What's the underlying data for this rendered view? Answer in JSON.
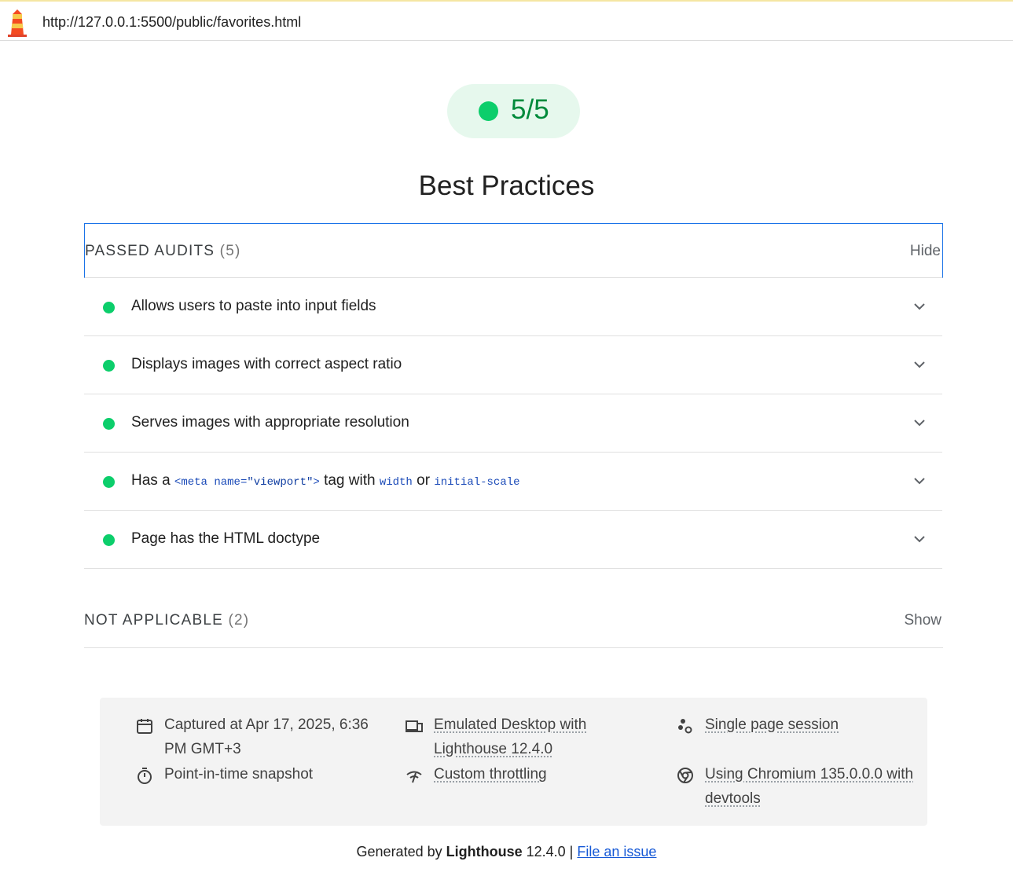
{
  "url_bar": {
    "logo_icon": "lighthouse-icon",
    "url": "http://127.0.0.1:5500/public/favorites.html"
  },
  "score": {
    "value": "5/5",
    "status_color": "#0cce6b"
  },
  "category": {
    "title": "Best Practices"
  },
  "passed_group": {
    "title": "PASSED AUDITS",
    "count": "(5)",
    "toggle_label": "Hide",
    "audits": [
      {
        "title": "Allows users to paste into input fields"
      },
      {
        "title": "Displays images with correct aspect ratio"
      },
      {
        "title": "Serves images with appropriate resolution"
      },
      {
        "title_prefix": "Has a",
        "code_tag_open": "<meta",
        "code_attr": "name=",
        "code_val": "\"viewport\"",
        "code_tag_close": ">",
        "title_mid": "tag with",
        "code_width": "width",
        "title_or": "or",
        "code_scale": "initial-scale"
      },
      {
        "title": "Page has the HTML doctype"
      }
    ]
  },
  "na_group": {
    "title": "NOT APPLICABLE",
    "count": "(2)",
    "toggle_label": "Show"
  },
  "env_info": {
    "captured_line1": "Captured at Apr 17, 2025, 6:36",
    "captured_line2": "PM GMT+3",
    "snapshot": "Point-in-time snapshot",
    "emulated_line1": "Emulated Desktop with",
    "emulated_line2": "Lighthouse 12.4.0",
    "throttling": "Custom throttling",
    "session": "Single page session",
    "chromium_line1": "Using Chromium 135.0.0.0 with",
    "chromium_line2": "devtools"
  },
  "footer": {
    "generated_by": "Generated by",
    "product": "Lighthouse",
    "version": "12.4.0 |",
    "issue_link": "File an issue"
  }
}
